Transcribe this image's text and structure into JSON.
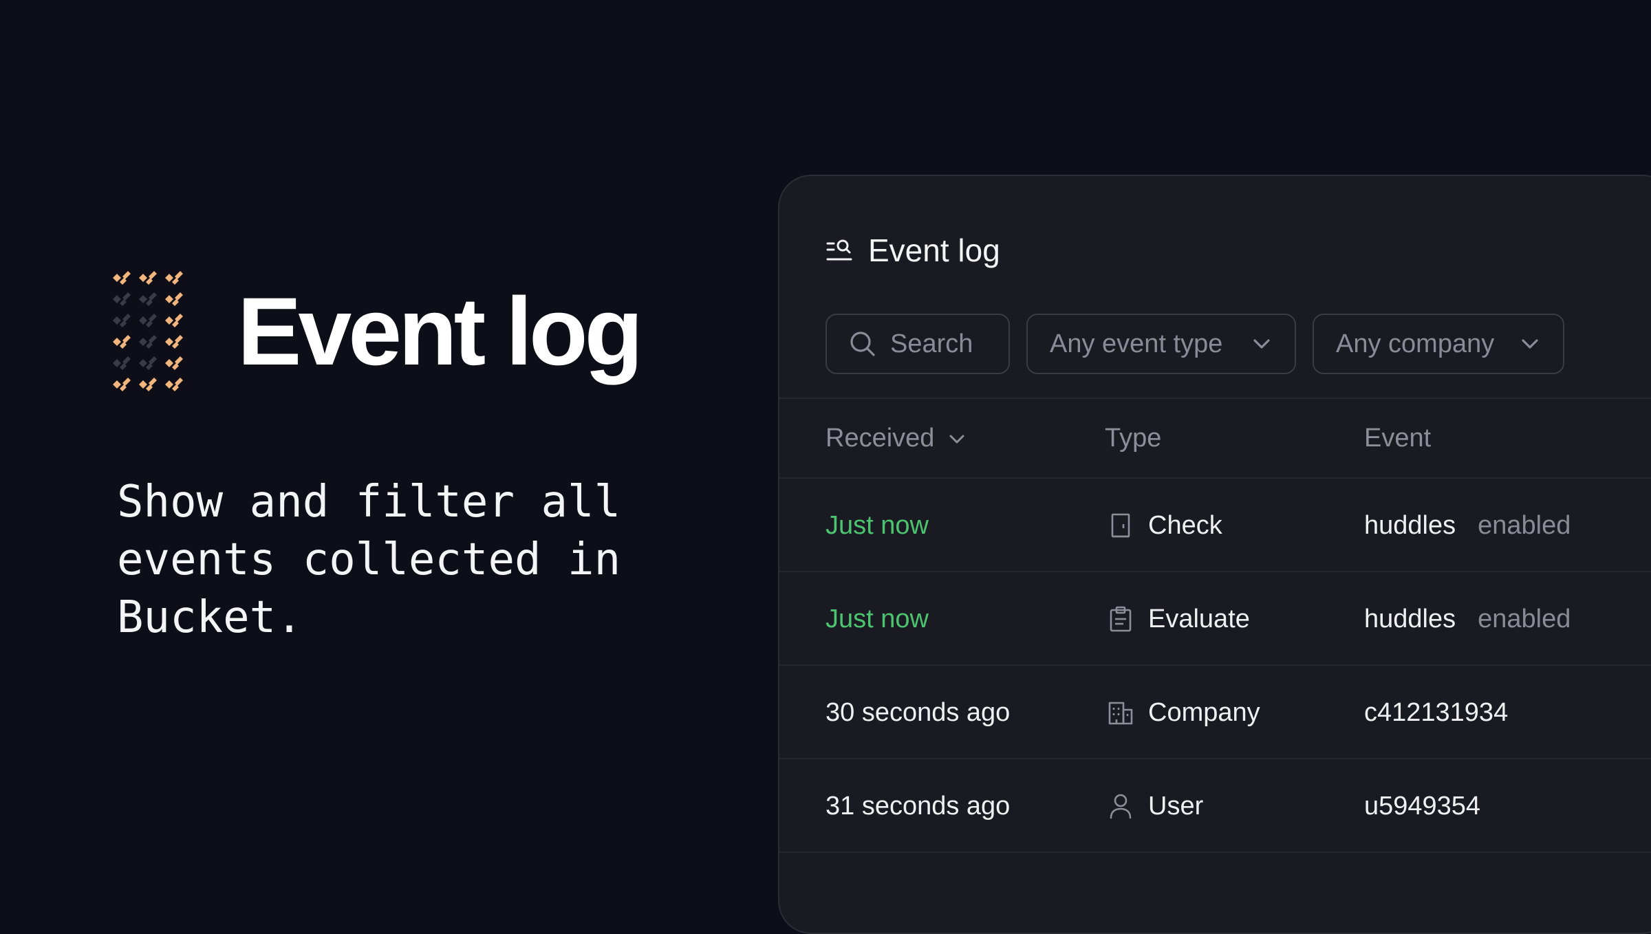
{
  "hero": {
    "title": "Event log",
    "description": "Show and filter all events collected in Bucket.",
    "logo_icon": "bucket-logo-icon"
  },
  "panel": {
    "title": "Event log",
    "title_icon": "event-log-icon",
    "filters": {
      "search_placeholder": "Search",
      "event_type": "Any event type",
      "company": "Any company"
    },
    "columns": {
      "received": "Received",
      "type": "Type",
      "event": "Event"
    },
    "rows": [
      {
        "received": "Just now",
        "type": "Check",
        "type_icon": "check-icon",
        "event": "huddles",
        "state": "enabled"
      },
      {
        "received": "Just now",
        "type": "Evaluate",
        "type_icon": "clipboard-icon",
        "event": "huddles",
        "state": "enabled"
      },
      {
        "received": "30 seconds ago",
        "type": "Company",
        "type_icon": "building-icon",
        "event": "c412131934",
        "state": ""
      },
      {
        "received": "31 seconds ago",
        "type": "User",
        "type_icon": "user-icon",
        "event": "u5949354",
        "state": ""
      }
    ]
  },
  "colors": {
    "background": "#0d0e18",
    "panel": "#1a1b22",
    "recent_text": "#4cc36f",
    "logo_accent": "#f2b57d",
    "logo_dim": "#3a3b46"
  }
}
